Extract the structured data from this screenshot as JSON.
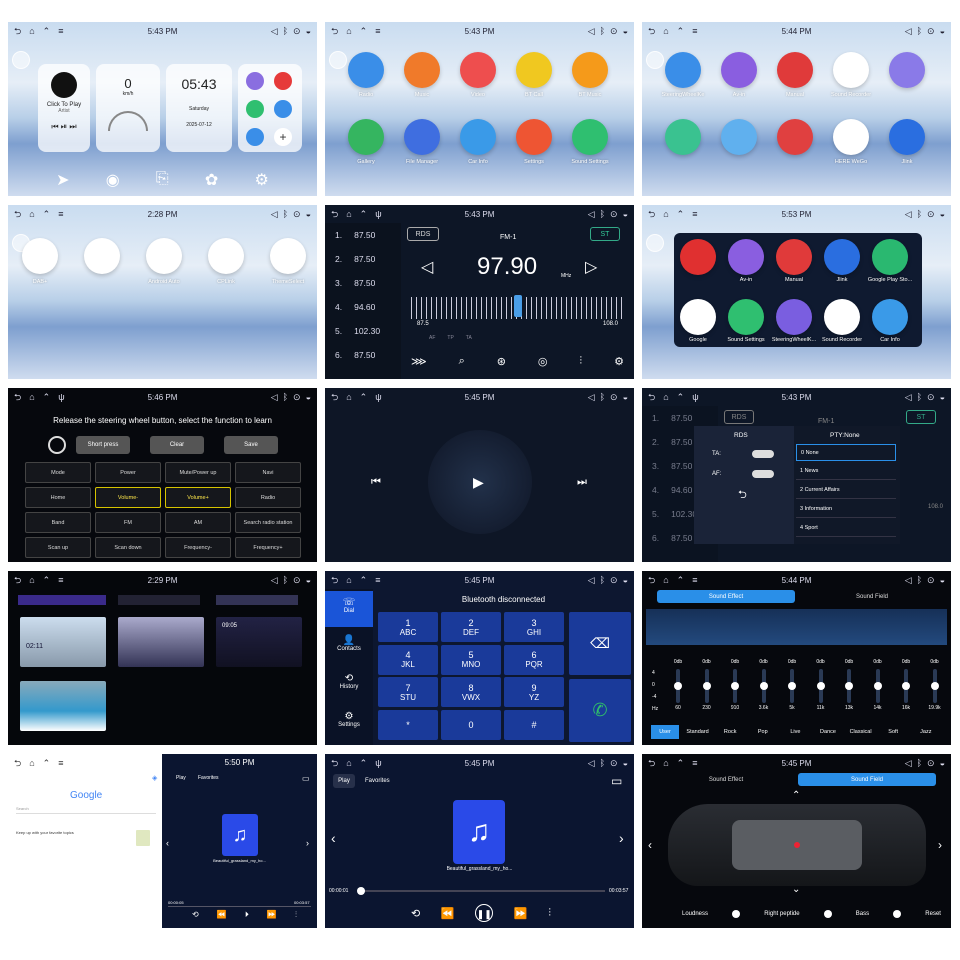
{
  "status": {
    "icons_left": [
      "back-icon",
      "home-icon",
      "chevron-up-icon",
      "menu-icon"
    ],
    "icons_right": [
      "volume-icon",
      "bluetooth-icon",
      "location-icon",
      "wifi-icon"
    ]
  },
  "t1": {
    "time": "5:43 PM",
    "music_title": "Click To Play",
    "music_artist": "Artist",
    "speed": "0",
    "speed_unit": "km/h",
    "clock": "05:43",
    "day": "Saturday",
    "date": "2025-07-12"
  },
  "t2": {
    "time": "5:43 PM",
    "apps": [
      {
        "label": "Radio",
        "color": "#3a8ee8"
      },
      {
        "label": "Music",
        "color": "#f07a2a"
      },
      {
        "label": "Video",
        "color": "#ee4e4e"
      },
      {
        "label": "BT Call",
        "color": "#f0c820"
      },
      {
        "label": "BT Music",
        "color": "#f59a1a"
      },
      {
        "label": "Gallery",
        "color": "#35b560"
      },
      {
        "label": "File Manager",
        "color": "#3f6ee0"
      },
      {
        "label": "Car Info",
        "color": "#3a9ae8"
      },
      {
        "label": "Settings",
        "color": "#ee5533"
      },
      {
        "label": "Sound Settings",
        "color": "#2fbf70"
      }
    ]
  },
  "t3": {
    "time": "5:44 PM",
    "apps": [
      {
        "label": "SteeringWheelKe",
        "color": "#3a8ee8"
      },
      {
        "label": "Av-in",
        "color": "#8a5ee0"
      },
      {
        "label": "Manual",
        "color": "#e03a3a"
      },
      {
        "label": "Sound Recorder",
        "color": "#ffffff"
      },
      {
        "label": "",
        "color": "#8a7ae8"
      },
      {
        "label": "",
        "color": "#3ac290"
      },
      {
        "label": "",
        "color": "#60b0ee"
      },
      {
        "label": "",
        "color": "#e04040"
      },
      {
        "label": "HERE WeGo",
        "color": "#ffffff"
      },
      {
        "label": "Jlink",
        "color": "#2a6ee0"
      }
    ]
  },
  "t4": {
    "time": "2:28 PM",
    "apps": [
      {
        "label": "DAB+",
        "color": "#ffffff"
      },
      {
        "label": "",
        "color": "#ffffff"
      },
      {
        "label": "Android Auto",
        "color": "#ffffff"
      },
      {
        "label": "CPLink",
        "color": "#ffffff"
      },
      {
        "label": "ThemeSelect",
        "color": "#ffffff"
      }
    ]
  },
  "t5": {
    "time": "5:43 PM",
    "presets": [
      {
        "n": "1.",
        "f": "87.50"
      },
      {
        "n": "2.",
        "f": "87.50"
      },
      {
        "n": "3.",
        "f": "87.50"
      },
      {
        "n": "4.",
        "f": "94.60"
      },
      {
        "n": "5.",
        "f": "102.30"
      },
      {
        "n": "6.",
        "f": "87.50"
      }
    ],
    "rds": "RDS",
    "band": "FM-1",
    "st": "ST",
    "freq": "97.90",
    "unit": "MHz",
    "min": "87.5",
    "max": "108.0",
    "flags": [
      "AF",
      "TP",
      "TA"
    ]
  },
  "t6": {
    "time": "5:53 PM",
    "apps": [
      {
        "label": "",
        "color": "#e03030"
      },
      {
        "label": "Av-in",
        "color": "#8a5ee0"
      },
      {
        "label": "Manual",
        "color": "#e03a3a"
      },
      {
        "label": "Jlink",
        "color": "#2a6ee0"
      },
      {
        "label": "Google Play Sto...",
        "color": "#2ab870"
      },
      {
        "label": "Google",
        "color": "#ffffff"
      },
      {
        "label": "Sound Settings",
        "color": "#2fbf70"
      },
      {
        "label": "SteeringWheelK...",
        "color": "#7a5ee0"
      },
      {
        "label": "Sound Recorder",
        "color": "#ffffff"
      },
      {
        "label": "Car Info",
        "color": "#3a9ae8"
      }
    ]
  },
  "t7": {
    "time": "5:46 PM",
    "title": "Release the steering wheel button, select the function to learn",
    "short_press": "Short press",
    "clear": "Clear",
    "save": "Save",
    "functions": [
      "Mode",
      "Power",
      "Mute/Power up",
      "Navi",
      "Home",
      "Volume-",
      "Volume+",
      "Radio",
      "Band",
      "FM",
      "AM",
      "Search radio station",
      "Scan up",
      "Scan down",
      "Frequency-",
      "Frequency+"
    ]
  },
  "t8": {
    "time": "5:45 PM"
  },
  "t9": {
    "time": "5:43 PM",
    "presets": [
      "87.50",
      "87.50",
      "87.50",
      "94.60",
      "102.30",
      "87.50"
    ],
    "rds": "RDS",
    "band": "FM-1",
    "st": "ST",
    "dialog_rds": "RDS",
    "pty": "PTY:None",
    "ta": "TA:",
    "af": "AF:",
    "pty_items": [
      "0 None",
      "1 News",
      "2 Current Affairs",
      "3 Information",
      "4 Sport"
    ],
    "max": "108.0"
  },
  "t10": {
    "time": "2:29 PM",
    "mini_clock": "02:11",
    "mini_clock2": "09:05"
  },
  "t11": {
    "time": "5:45 PM",
    "status": "Bluetooth disconnected",
    "tabs": [
      "Dial",
      "Contacts",
      "History",
      "Settings"
    ],
    "keys": [
      {
        "d": "1",
        "l": "ABC"
      },
      {
        "d": "2",
        "l": "DEF"
      },
      {
        "d": "3",
        "l": "GHI"
      },
      {
        "d": "4",
        "l": "JKL"
      },
      {
        "d": "5",
        "l": "MNO"
      },
      {
        "d": "6",
        "l": "PQR"
      },
      {
        "d": "7",
        "l": "STU"
      },
      {
        "d": "8",
        "l": "VWX"
      },
      {
        "d": "9",
        "l": "YZ"
      },
      {
        "d": "*",
        "l": ""
      },
      {
        "d": "0",
        "l": ""
      },
      {
        "d": "#",
        "l": ""
      }
    ]
  },
  "t12": {
    "time": "5:44 PM",
    "tab1": "Sound Effect",
    "tab2": "Sound Field",
    "db": "0db",
    "axis": [
      "4",
      "0",
      "-4"
    ],
    "hz": "Hz",
    "bands": [
      "60",
      "230",
      "910",
      "3.6k",
      "5k",
      "11k",
      "13k",
      "14k",
      "16k",
      "19.9k"
    ],
    "presets": [
      "User",
      "Standard",
      "Rock",
      "Pop",
      "Live",
      "Dance",
      "Classical",
      "Soft",
      "Jazz"
    ]
  },
  "t13": {
    "time": "5:50 PM",
    "search": "Search",
    "google_text": "Keep up with your favorite topics",
    "tab_play": "Play",
    "tab_fav": "Favorites",
    "song": "Beautiful_grassland_my_ho...",
    "pos": "00:00:05",
    "dur": "00:03:57"
  },
  "t14": {
    "time": "5:45 PM",
    "tab_play": "Play",
    "tab_fav": "Favorites",
    "song": "Beautiful_grassland_my_ho...",
    "pos": "00:00:01",
    "dur": "00:03:57",
    "progress": 0.01
  },
  "t15": {
    "time": "5:45 PM",
    "tab1": "Sound Effect",
    "tab2": "Sound Field",
    "loudness": "Loudness",
    "right": "Right peptide",
    "bass": "Bass",
    "reset": "Reset"
  }
}
